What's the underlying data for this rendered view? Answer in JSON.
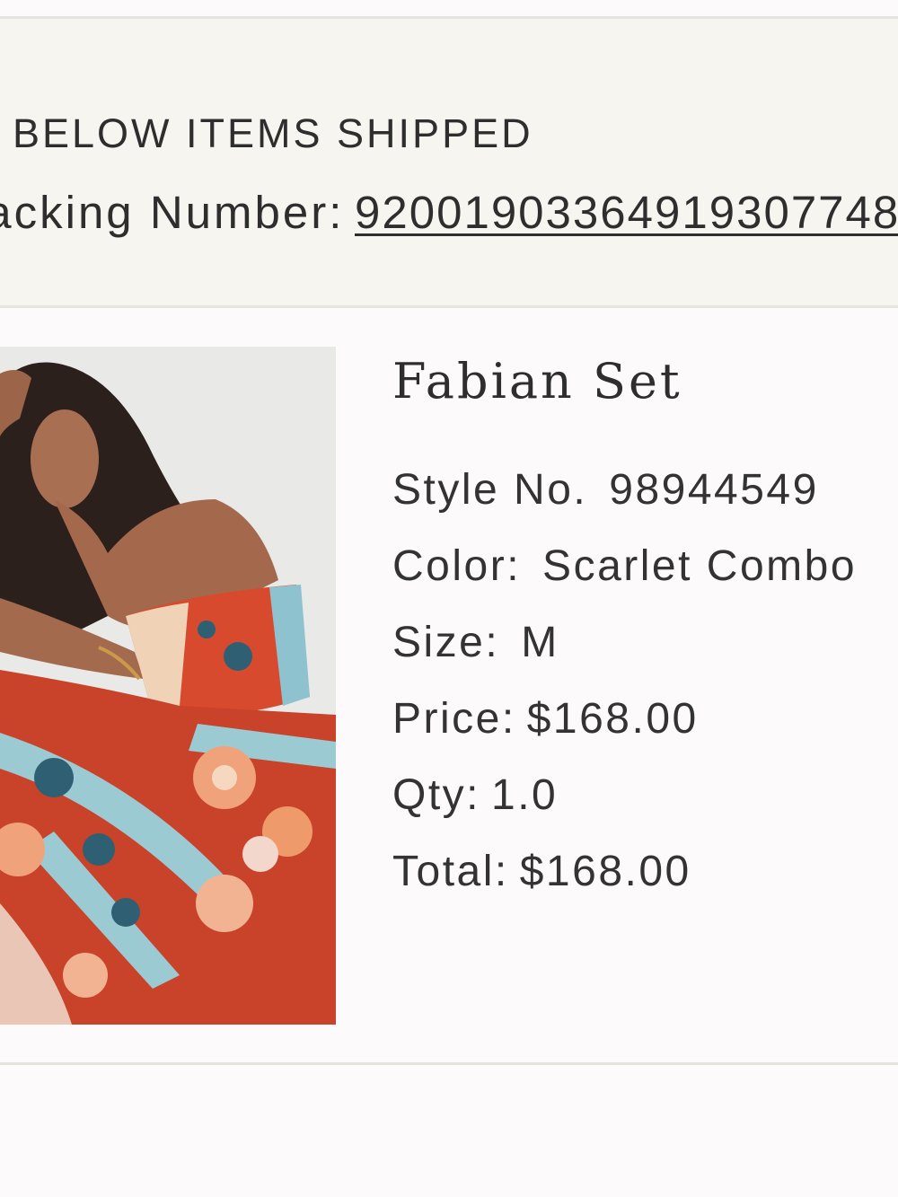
{
  "shipment": {
    "status": "BELOW ITEMS SHIPPED",
    "tracking_label": "Tracking Number:",
    "tracking_number": "92001903364919307748"
  },
  "product": {
    "image_alt": "Model wearing a red floral print strapless top and maxi skirt set",
    "name": "Fabian Set",
    "style_label": "Style No.",
    "style_value": "98944549",
    "color_label": "Color:",
    "color_value": "Scarlet Combo",
    "size_label": "Size:",
    "size_value": "M",
    "price_label": "Price:",
    "price_value": "$168.00",
    "qty_label": "Qty:",
    "qty_value": "1.0",
    "total_label": "Total:",
    "total_value": "$168.00"
  },
  "colors": {
    "page_bg": "#fcfafa",
    "banner_bg": "#f7f5ef",
    "divider": "#e7e3df",
    "text": "#2e2e2e"
  }
}
